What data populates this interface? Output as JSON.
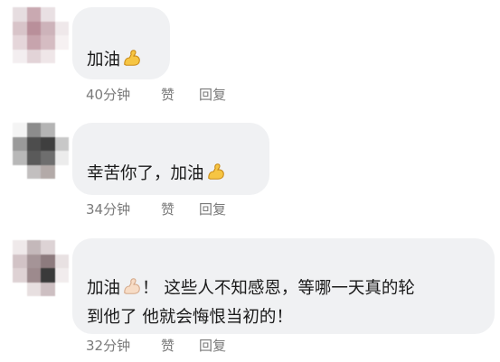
{
  "comments": [
    {
      "text": "加油",
      "emoji": "flexed-biceps-icon",
      "time": "40分钟",
      "like": "赞",
      "reply": "回复"
    },
    {
      "text": "幸苦你了，加油",
      "emoji": "flexed-biceps-icon",
      "time": "34分钟",
      "like": "赞",
      "reply": "回复"
    },
    {
      "text_prefix": "加油",
      "emoji": "flexed-biceps-light-skin-icon",
      "text_suffix": "！ 这些人不知感恩，等哪一天真的轮",
      "text_line2": "到他了 他就会悔恨当初的！",
      "time": "32分钟",
      "like": "赞",
      "reply": "回复"
    }
  ],
  "colors": {
    "bubble": "#f0f1f3",
    "meta_text": "#7a7a7a",
    "biceps_yellow": "#f6c543",
    "biceps_light": "#f7dcc6"
  }
}
